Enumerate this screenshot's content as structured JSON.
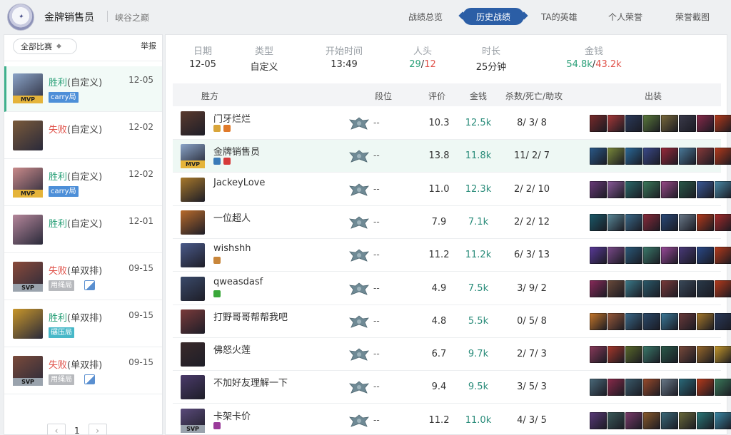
{
  "header": {
    "logo_icon": "summoner-logo",
    "username": "金牌销售员",
    "server": "峡谷之巅",
    "nav": [
      {
        "label": "战绩总览"
      },
      {
        "label": "历史战绩",
        "active": true
      },
      {
        "label": "TA的英雄"
      },
      {
        "label": "个人荣誉"
      },
      {
        "label": "荣誉截图"
      }
    ]
  },
  "sidebar": {
    "filter": "全部比赛",
    "report": "举报",
    "matches": [
      {
        "result": "胜利",
        "mode": "(自定义)",
        "date": "12-05",
        "tag": "carry局",
        "badge": "MVP",
        "outcome": "win",
        "active": true,
        "color": "#8aa4c8"
      },
      {
        "result": "失败",
        "mode": "(自定义)",
        "date": "12-02",
        "tag": "",
        "badge": "",
        "outcome": "lose",
        "color": "#7a5a3a"
      },
      {
        "result": "胜利",
        "mode": "(自定义)",
        "date": "12-02",
        "tag": "carry局",
        "badge": "MVP",
        "outcome": "win",
        "color": "#c98a8a"
      },
      {
        "result": "胜利",
        "mode": "(自定义)",
        "date": "12-01",
        "tag": "",
        "badge": "",
        "outcome": "win",
        "color": "#b4869a"
      },
      {
        "result": "失败",
        "mode": "(单双排)",
        "date": "09-15",
        "tag": "用绳局",
        "badge": "SVP",
        "outcome": "lose",
        "color": "#8a4a3a",
        "pic": true
      },
      {
        "result": "胜利",
        "mode": "(单双排)",
        "date": "09-15",
        "tag": "碾压局",
        "badge": "",
        "outcome": "win",
        "color": "#c8962a"
      },
      {
        "result": "失败",
        "mode": "(单双排)",
        "date": "09-15",
        "tag": "用绳局",
        "badge": "SVP",
        "outcome": "lose",
        "color": "#7a4a3a",
        "pic": true
      }
    ],
    "page": "1"
  },
  "summary": {
    "labels": [
      "日期",
      "类型",
      "开始时间",
      "人头",
      "时长",
      "金钱"
    ],
    "date": "12-05",
    "type": "自定义",
    "start_time": "13:49",
    "kills_team": "29",
    "kills_sep": "/",
    "kills_enemy": "12",
    "duration": "25分钟",
    "gold_team": "54.8k",
    "gold_sep": "/",
    "gold_enemy": "43.2k"
  },
  "table": {
    "headers": {
      "side": "胜方",
      "rank": "段位",
      "score": "评价",
      "gold": "金钱",
      "kda": "杀数/死亡/助攻",
      "items": "出装"
    },
    "rows": [
      {
        "name": "门牙烂烂",
        "rank": "--",
        "score": "10.3",
        "gold": "12.5k",
        "kda": "8/ 3/ 8",
        "avatar": "#5a3a2e",
        "badge": "",
        "b1": "#d9a53a",
        "b2": "#e07a2a",
        "items": [
          "#7a2a2a",
          "#a83838",
          "#2a3a5a",
          "#5a7a3a",
          "#7a6a3a",
          "#3a3a4a",
          "#8a2a4a",
          "#b83a1a"
        ]
      },
      {
        "name": "金牌销售员",
        "rank": "--",
        "score": "13.8",
        "gold": "11.8k",
        "kda": "11/ 2/ 7",
        "avatar": "#8aa4c8",
        "badge": "MVP",
        "me": true,
        "b1": "#3a7ab8",
        "b2": "#d63a3a",
        "items": [
          "#2a5a8a",
          "#7a8a3a",
          "#2a6a9a",
          "#3a4a8a",
          "#9a2a3a",
          "#4a7a9a",
          "#8a3a3a",
          "#b83a1a"
        ]
      },
      {
        "name": "JackeyLove",
        "rank": "--",
        "score": "11.0",
        "gold": "12.3k",
        "kda": "2/ 2/ 10",
        "avatar": "#a8782a",
        "badge": "",
        "b1": "",
        "b2": "",
        "items": [
          "#6a3a7a",
          "#8a5a9a",
          "#2a6a6a",
          "#3a7a5a",
          "#9a4a8a",
          "#2a5a4a",
          "#3a5a9a",
          "#4a8aa8"
        ]
      },
      {
        "name": "一位超人",
        "rank": "--",
        "score": "7.9",
        "gold": "7.1k",
        "kda": "2/ 2/ 12",
        "avatar": "#b86a2a",
        "badge": "",
        "b1": "",
        "b2": "",
        "items": [
          "#1a5a6a",
          "#5a8a9a",
          "#3a6a8a",
          "#8a2a3a",
          "#2a4a7a",
          "#6a7a8a",
          "#b83a1a",
          "#a82a2a"
        ]
      },
      {
        "name": "wishshh",
        "rank": "--",
        "score": "11.2",
        "gold": "11.2k",
        "kda": "6/ 3/ 13",
        "avatar": "#4a5a8a",
        "badge": "",
        "b1": "#c8863a",
        "b2": "",
        "items": [
          "#5a3a9a",
          "#7a4a8a",
          "#2a5a7a",
          "#3a7a6a",
          "#9a4a9a",
          "#4a3a7a",
          "#2a4a8a",
          "#b83a1a"
        ]
      },
      {
        "name": "qweasdasf",
        "rank": "--",
        "score": "4.9",
        "gold": "7.5k",
        "kda": "3/ 9/ 2",
        "avatar": "#3a4a6a",
        "badge": "",
        "b1": "#3aa83a",
        "b2": "",
        "items": [
          "#8a2a5a",
          "#6a4a3a",
          "#3a7a8a",
          "#2a5a6a",
          "#7a3a3a",
          "#3a4a5a",
          "#2a3a4a",
          "#b83a1a"
        ]
      },
      {
        "name": "打野哥哥帮帮我吧",
        "rank": "--",
        "score": "4.8",
        "gold": "5.5k",
        "kda": "0/ 5/ 8",
        "avatar": "#7a3a3a",
        "badge": "",
        "b1": "",
        "b2": "",
        "items": [
          "#c8782a",
          "#9a5a3a",
          "#3a6a8a",
          "#2a4a6a",
          "#3a7a9a",
          "#6a3a3a",
          "#a87a2a",
          "#2a3a5a"
        ]
      },
      {
        "name": "佛怒火莲",
        "rank": "--",
        "score": "6.7",
        "gold": "9.7k",
        "kda": "2/ 7/ 3",
        "avatar": "#3a2a2a",
        "badge": "",
        "b1": "",
        "b2": "",
        "items": [
          "#8a3a5a",
          "#a8382a",
          "#5a6a2a",
          "#3a7a6a",
          "#2a5a4a",
          "#7a4a3a",
          "#9a6a2a",
          "#c89a2a"
        ]
      },
      {
        "name": "不加好友理解一下",
        "rank": "--",
        "score": "9.4",
        "gold": "9.5k",
        "kda": "3/ 5/ 3",
        "avatar": "#4a3a6a",
        "badge": "",
        "b1": "",
        "b2": "",
        "items": [
          "#4a6a7a",
          "#8a2a4a",
          "#3a5a6a",
          "#9a4a2a",
          "#6a7a8a",
          "#2a6a7a",
          "#b83a1a",
          "#3a7a5a"
        ]
      },
      {
        "name": "卡架卡价",
        "rank": "--",
        "score": "11.2",
        "gold": "11.0k",
        "kda": "4/ 3/ 5",
        "avatar": "#5a4a7a",
        "badge": "SVP",
        "b1": "#9a3a9a",
        "b2": "",
        "items": [
          "#5a3a7a",
          "#3a5a5a",
          "#7a3a6a",
          "#8a5a2a",
          "#3a6a7a",
          "#6a6a3a",
          "#2a7a7a",
          "#3a8aa8"
        ]
      }
    ]
  }
}
